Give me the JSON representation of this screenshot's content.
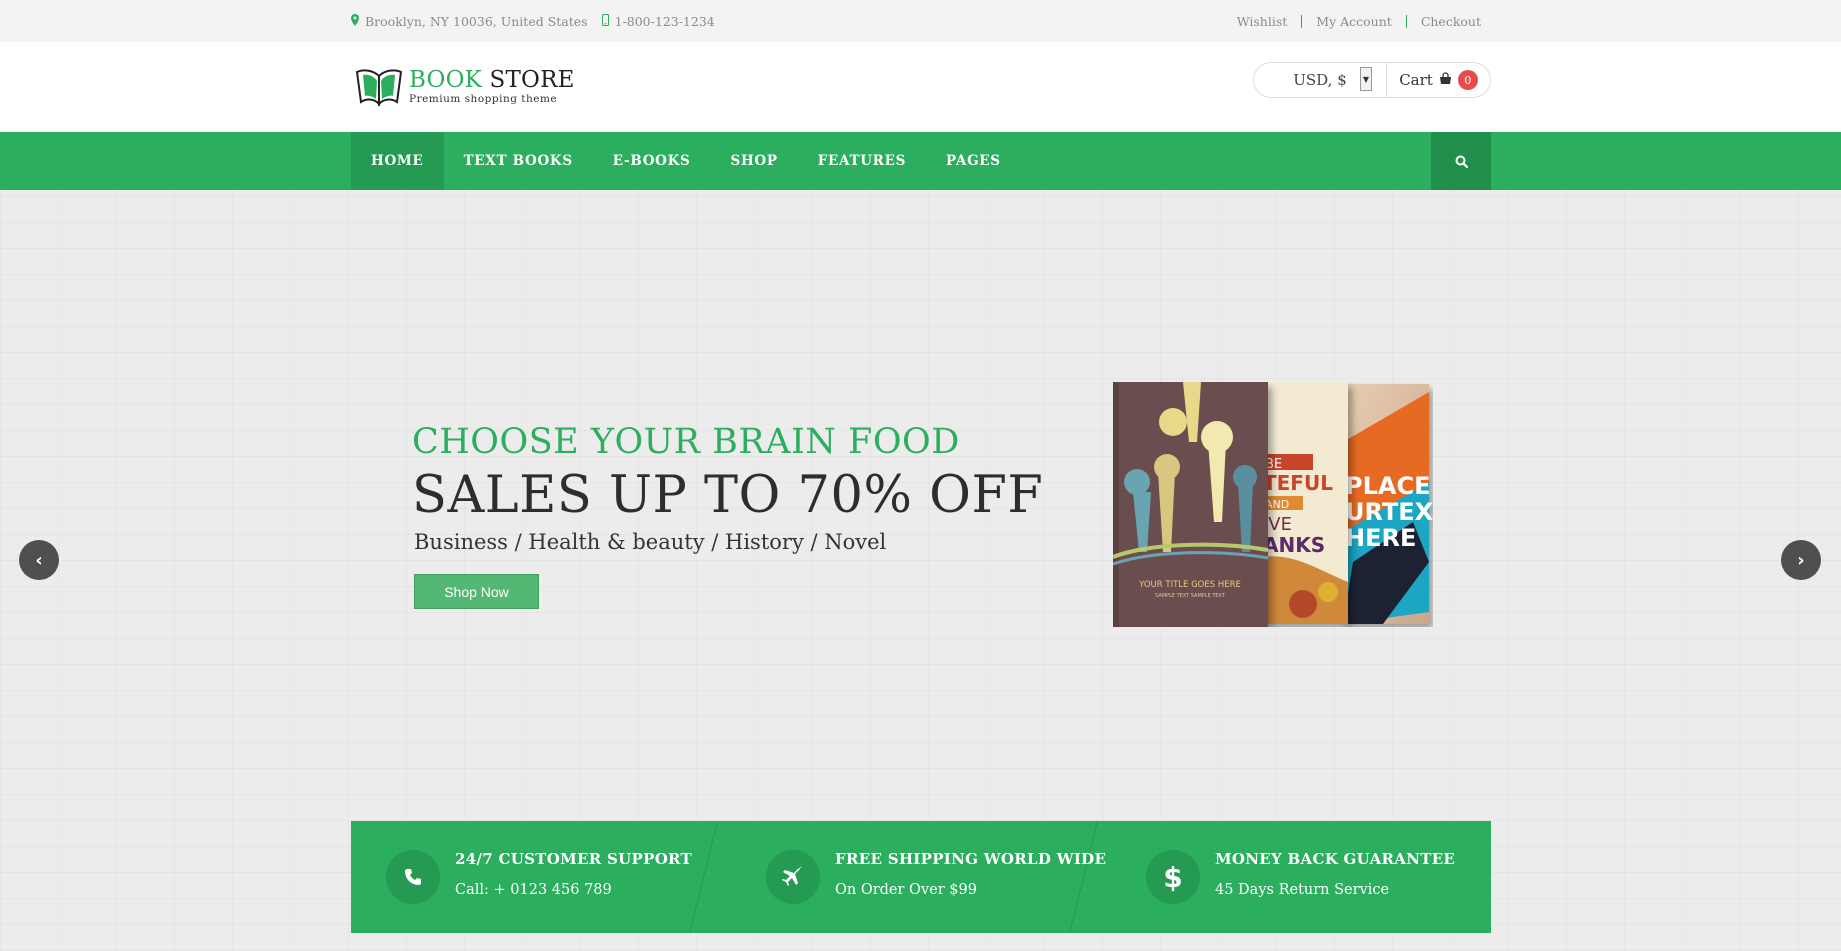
{
  "topbar": {
    "address": "Brooklyn, NY 10036, United States",
    "phone": "1-800-123-1234",
    "links": [
      "Wishlist",
      "My Account",
      "Checkout"
    ]
  },
  "header": {
    "logo_part1": "BOOK",
    "logo_part2": " STORE",
    "logo_tagline": "Premium shopping theme",
    "currency": "USD, $",
    "cart_label": "Cart",
    "cart_count": "0"
  },
  "nav": {
    "items": [
      "HOME",
      "TEXT BOOKS",
      "E-BOOKS",
      "SHOP",
      "FEATURES",
      "PAGES"
    ],
    "active": "HOME"
  },
  "hero": {
    "kicker": "CHOOSE YOUR BRAIN FOOD",
    "headline": "SALES UP TO 70% OFF",
    "categories": "Business / Health & beauty / History / Novel",
    "cta": "Shop Now",
    "book1_title": "YOUR TITLE GOES HERE",
    "book1_sub": "SAMPLE TEXT SAMPLE TEXT",
    "book2_text": [
      "BE",
      "TEFUL",
      "AND",
      "IVE",
      "ANKS"
    ],
    "book3_text": [
      "PLACE",
      "URTEXT",
      "HERE"
    ]
  },
  "features": [
    {
      "icon": "phone-icon",
      "title": "24/7 CUSTOMER SUPPORT",
      "sub": "Call: + 0123 456 789"
    },
    {
      "icon": "plane-icon",
      "title": "FREE SHIPPING WORLD WIDE",
      "sub": "On Order Over $99"
    },
    {
      "icon": "dollar-icon",
      "title": "MONEY BACK GUARANTEE",
      "sub": "45 Days Return Service"
    }
  ],
  "colors": {
    "brand_green": "#2bae5e",
    "nav_active": "#249a52",
    "badge_red": "#e74c4c"
  }
}
